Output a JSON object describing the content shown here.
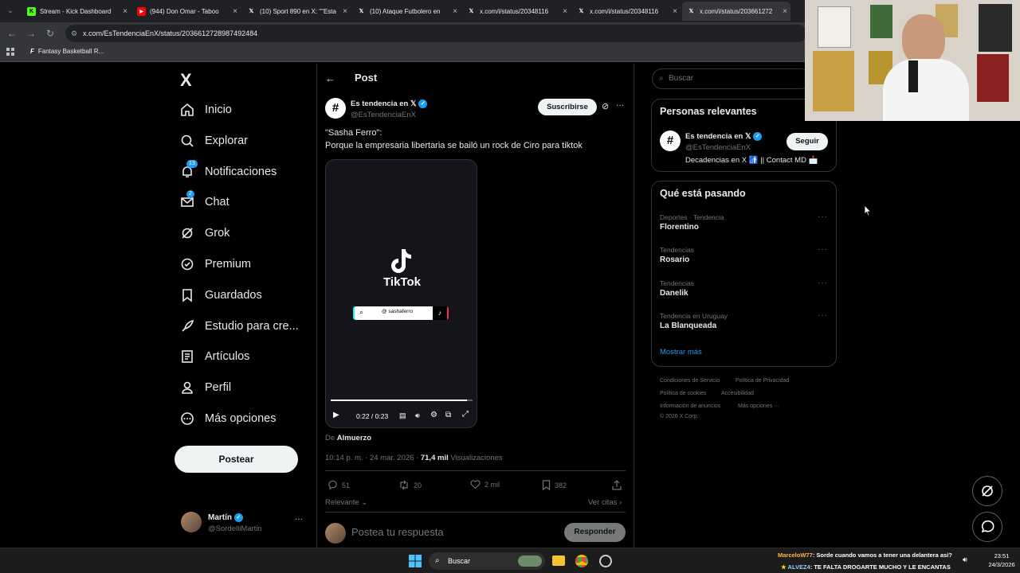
{
  "browser": {
    "tabs": [
      {
        "title": "Stream - Kick Dashboard",
        "favicon": "kick-icon",
        "color": "#53fc18"
      },
      {
        "title": "(944) Don Omar - Taboo",
        "favicon": "youtube-icon",
        "color": "#ff0000"
      },
      {
        "title": "(10) Sport 890 en X: \"\"Esta",
        "favicon": "x-icon",
        "color": "#ffffff"
      },
      {
        "title": "(10) Ataque Futbolero en",
        "favicon": "x-icon",
        "color": "#ffffff"
      },
      {
        "title": "x.com/i/status/20348116",
        "favicon": "x-icon",
        "color": "#ffffff"
      },
      {
        "title": "x.com/i/status/20348116",
        "favicon": "x-icon",
        "color": "#ffffff"
      },
      {
        "title": "x.com/i/status/203661272",
        "favicon": "x-icon",
        "color": "#ffffff"
      }
    ],
    "url": "x.com/EsTendenciaEnX/status/2036612728987492484",
    "bookmark": "Fantasy Basketball R..."
  },
  "sidebar": {
    "logo": "X",
    "items": [
      {
        "label": "Inicio",
        "icon": "home-icon"
      },
      {
        "label": "Explorar",
        "icon": "search-icon"
      },
      {
        "label": "Notificaciones",
        "icon": "bell-icon",
        "badge": "13"
      },
      {
        "label": "Chat",
        "icon": "mail-icon",
        "badge": "2"
      },
      {
        "label": "Grok",
        "icon": "grok-icon"
      },
      {
        "label": "Premium",
        "icon": "verified-badge-icon"
      },
      {
        "label": "Guardados",
        "icon": "bookmark-icon"
      },
      {
        "label": "Estudio para cre...",
        "icon": "rocket-icon"
      },
      {
        "label": "Artículos",
        "icon": "article-icon"
      },
      {
        "label": "Perfil",
        "icon": "person-icon"
      },
      {
        "label": "Más opciones",
        "icon": "more-circle-icon"
      }
    ],
    "post_button": "Postear",
    "user": {
      "name": "Martín",
      "handle": "@SordelliMartin"
    }
  },
  "post": {
    "header": "Post",
    "author_name": "Es tendencia en 𝕏",
    "author_handle": "@EsTendenciaEnX",
    "subscribe": "Suscribirse",
    "text_line1": "\"Sasha Ferro\":",
    "text_line2": "Porque la empresaria libertaria se bailó un rock de Ciro para tiktok",
    "video": {
      "brand": "TikTok",
      "search_text": "@ sashaferro",
      "time": "0:22 / 0:23",
      "progress": 0.96
    },
    "from_prefix": "De",
    "from_name": "Almuerzo",
    "timestamp": "10:14 p. m. · 24 mar. 2026 ·",
    "views_count": "71,4 mil",
    "views_label": "Visualizaciones",
    "metrics": {
      "replies": "51",
      "reposts": "20",
      "likes": "2 mil",
      "bookmarks": "382"
    },
    "sort": "Relevante",
    "quotes": "Ver citas",
    "reply_placeholder": "Postea tu respuesta",
    "reply_button": "Responder"
  },
  "right": {
    "search_placeholder": "Buscar",
    "relevant_title": "Personas relevantes",
    "person": {
      "name": "Es tendencia en 𝕏",
      "handle": "@EsTendenciaEnX",
      "follow": "Seguir",
      "bio": "Decadencias en X 🚮 || Contact MD 📩"
    },
    "trends_title": "Qué está pasando",
    "trends": [
      {
        "category": "Deportes · Tendencia",
        "name": "Florentino"
      },
      {
        "category": "Tendencias",
        "name": "Rosario"
      },
      {
        "category": "Tendencias",
        "name": "Danelik"
      },
      {
        "category": "Tendencia en Uruguay",
        "name": "La Blanqueada"
      }
    ],
    "show_more": "Mostrar más",
    "footer": [
      "Condiciones de Servicio",
      "Política de Privacidad",
      "Política de cookies",
      "Accesibilidad",
      "Información de anuncios",
      "Más opciones ···",
      "© 2026 X Corp."
    ]
  },
  "taskbar": {
    "search": "Buscar",
    "time": "23:51",
    "date": "24/3/2026",
    "chat1_user": "MarceloW77",
    "chat1_text": ": Sorde cuando vamos a tener una delantera así?",
    "chat2_user": "ALVEZ4",
    "chat2_text": ": TE FALTA DROGARTE MUCHO Y LE ENCANTAS"
  },
  "colors": {
    "accent": "#1d9bf0",
    "bg": "#000000",
    "muted": "#71767b",
    "border": "#2f3336"
  }
}
